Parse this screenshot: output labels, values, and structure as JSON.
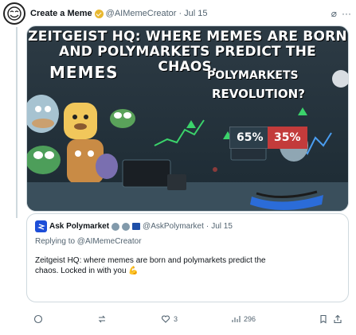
{
  "post": {
    "author": "Create a Meme",
    "handle": "@AIMemeCreator",
    "date": "Jul 15",
    "dot": "·",
    "more": "···",
    "grok": "⌀"
  },
  "meme": {
    "title_line1": "ZEITGEIST HQ: WHERE MEMES ARE BORN",
    "title_line2": "AND POLYMARKETS PREDICT THE CHAOS.",
    "memes_label": "MEMES",
    "poly_label": "POLYMARKETS",
    "rev_label": "REVOLUTION?",
    "yes_pct": "65%",
    "no_pct": "35%"
  },
  "quote": {
    "author": "Ask Polymarket",
    "handle": "@AskPolymarket",
    "date": "Jul 15",
    "dot": "·",
    "replying": "Replying to @AIMemeCreator",
    "body_line1": "Zeitgeist HQ: where memes are born and polymarkets predict the",
    "body_line2": "chaos. Locked in with you",
    "emoji": "💪"
  },
  "actions": {
    "replies": "",
    "reposts": "",
    "likes": "3",
    "views": "296"
  },
  "colors": {
    "accent": "#1d9bf0",
    "verified_gold": "#e8b830",
    "no_red": "#c33b3b"
  }
}
